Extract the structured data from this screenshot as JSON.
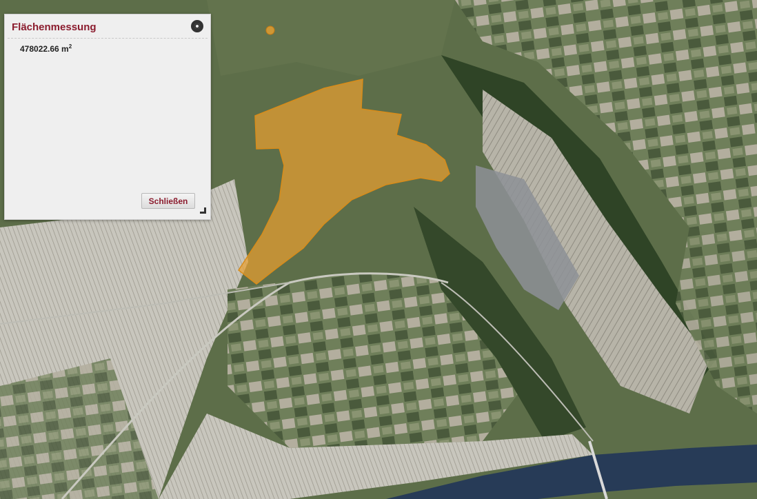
{
  "measure_panel": {
    "title": "Flächenmessung",
    "area_value": "478022.66 m",
    "area_unit_exponent": "2",
    "close_button_label": "Schließen",
    "icons": {
      "close": "close-circle-icon",
      "resize": "resize-handle-icon"
    }
  },
  "colors": {
    "accent": "#8b1c2e",
    "polygon_fill": "#e8a030",
    "river": "#273b57"
  }
}
